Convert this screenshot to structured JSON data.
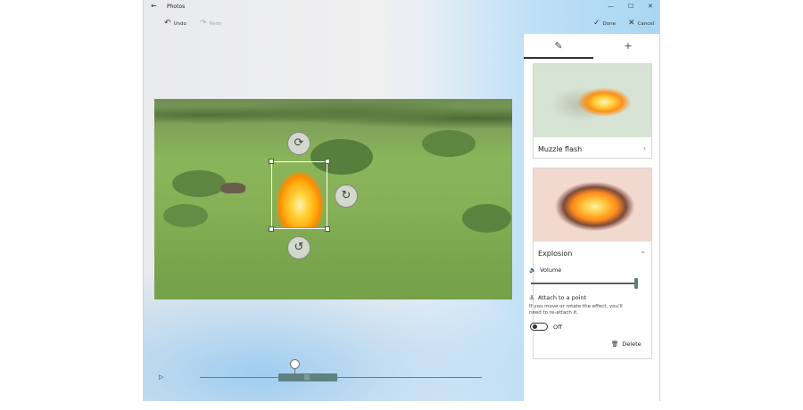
{
  "window": {
    "title": "Photos",
    "back_icon": "back-arrow-icon",
    "min_glyph": "—",
    "max_glyph": "☐",
    "close_glyph": "✕",
    "back_glyph": "←"
  },
  "toolbar": {
    "undo_label": "Undo",
    "undo_glyph": "↶",
    "redo_label": "Redo",
    "redo_glyph": "↷",
    "done_label": "Done",
    "done_glyph": "✓",
    "cancel_label": "Cancel",
    "cancel_glyph": "✕"
  },
  "canvas": {
    "rotate_glyph": "⟳",
    "rotate_right_glyph": "↻",
    "rotate_down_glyph": "↺"
  },
  "panel": {
    "tabs": [
      {
        "glyph": "✎",
        "active": true
      },
      {
        "glyph": "+",
        "active": false
      }
    ],
    "effects": [
      {
        "label": "Muzzle flash",
        "chevron": "›"
      },
      {
        "label": "Explosion",
        "chevron": "⌄"
      }
    ],
    "volume_label": "Volume",
    "volume_glyph": "🔈",
    "volume_level": 1.0,
    "attach_label": "Attach to a point",
    "attach_glyph": "⚓",
    "attach_help": "If you move or rotate the effect, you'll need to re-attach it.",
    "toggle_state": "Off",
    "delete_label": "Delete",
    "delete_glyph": "🗑"
  },
  "timeline": {
    "play_glyph": "▷",
    "trim_glyph": "|||",
    "playhead_fraction": 0.34
  },
  "colors": {
    "accent": "#5e8280",
    "panel_bg": "#ffffff",
    "window_edge": "#c8d6e0"
  }
}
